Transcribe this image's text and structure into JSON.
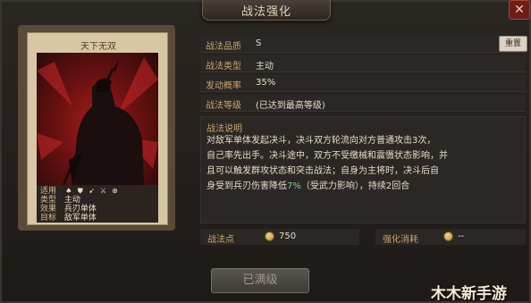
{
  "window": {
    "title": "战法强化",
    "close_label": "✕"
  },
  "card": {
    "name": "天下无双",
    "info": {
      "suit_key": "适用",
      "type_key": "类型",
      "type_val": "主动",
      "effect_key": "效果",
      "effect_val": "兵刃单体",
      "target_key": "目标",
      "target_val": "敌军单体"
    },
    "suit_icons": [
      "♠",
      "⛊",
      "➹",
      "⚔",
      "⊕"
    ]
  },
  "details": {
    "quality": {
      "label": "战法品质",
      "value": "S"
    },
    "type": {
      "label": "战法类型",
      "value": "主动"
    },
    "rate": {
      "label": "发动概率",
      "value": "35%"
    },
    "level": {
      "label": "战法等级",
      "value": "(已达到最高等级)"
    },
    "reset_label": "重置"
  },
  "description": {
    "title": "战法说明",
    "line1": "对敌军单体发起决斗，决斗双方轮流向对方普通攻击3次，",
    "line2": "自己率先出手。决斗途中，双方不受缴械和震慑状态影响，并",
    "line3": "且可以触发群攻状态和突击战法；自身为主将时，决斗后自",
    "line4_pre": "身受到兵刃伤害降低",
    "line4_hl": "7%",
    "line4_post": "（受武力影响），持续2回合"
  },
  "points": {
    "label": "战法点",
    "value": "750"
  },
  "consume": {
    "label": "强化消耗",
    "value": "--"
  },
  "action": {
    "label": "已满级"
  },
  "watermark": "木木新手游"
}
